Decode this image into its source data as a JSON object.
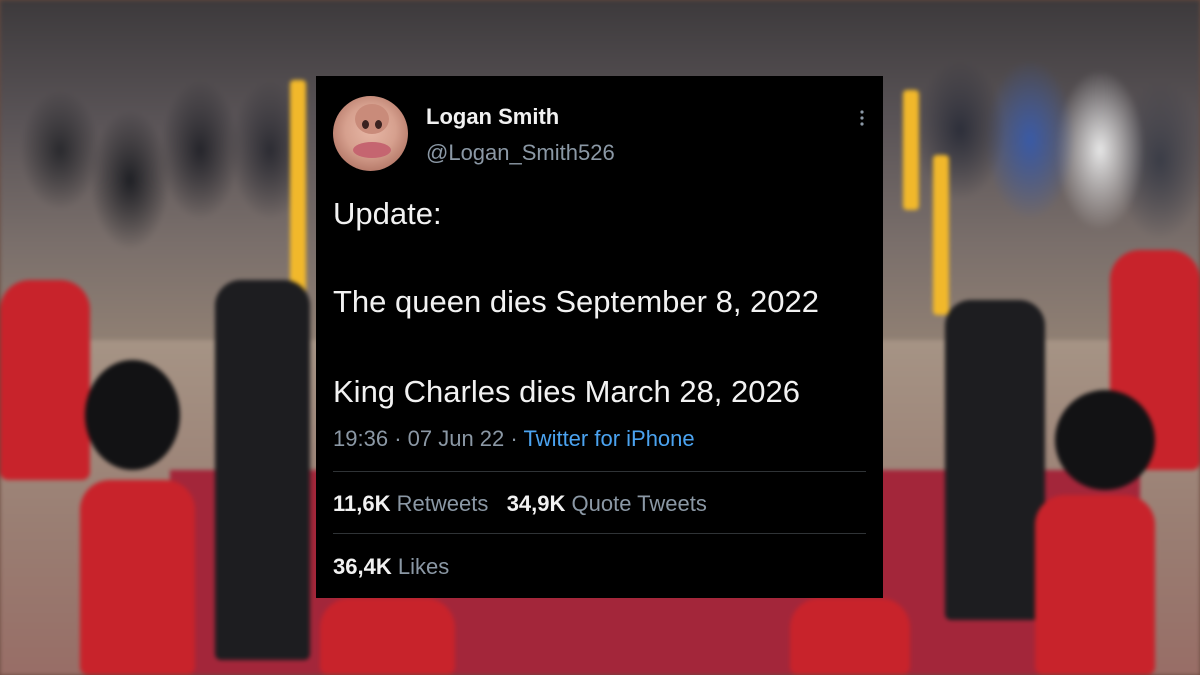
{
  "tweet": {
    "display_name": "Logan Smith",
    "handle": "@Logan_Smith526",
    "more_icon": "more-vertical-icon",
    "text_lines": [
      "Update:",
      "The queen dies September 8, 2022",
      "King Charles dies March 28, 2026"
    ],
    "time": "19:36",
    "date": "07 Jun 22",
    "separator": "·",
    "source": "Twitter for iPhone",
    "retweets_count": "11,6K",
    "retweets_label": "Retweets",
    "quotes_count": "34,9K",
    "quotes_label": "Quote Tweets",
    "likes_count": "36,4K",
    "likes_label": "Likes"
  },
  "colors": {
    "card_bg": "#000000",
    "text": "#e7e9ea",
    "muted": "#8b98a5",
    "link": "#4ba3f0",
    "divider": "#2f3336"
  }
}
